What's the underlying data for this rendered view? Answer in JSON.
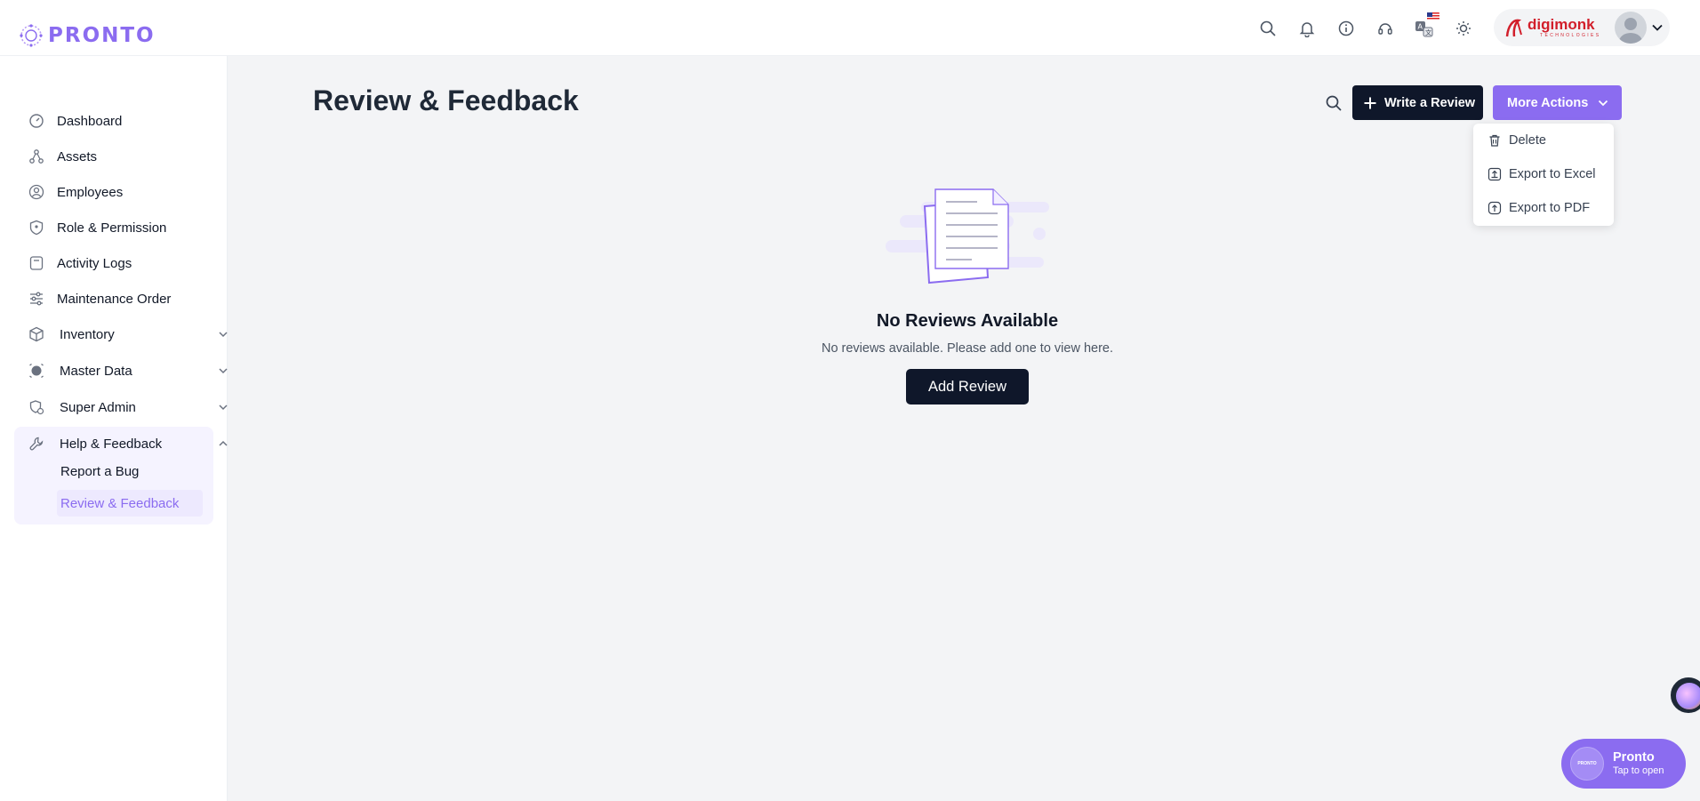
{
  "app": {
    "name": "PRONTO"
  },
  "header": {
    "icons": [
      "search-icon",
      "bell-icon",
      "info-icon",
      "support-icon",
      "translate-icon",
      "sun-icon"
    ],
    "brand": {
      "name": "digimonk",
      "sub": "TECHNOLOGIES"
    }
  },
  "sidebar": {
    "items": [
      {
        "label": "Dashboard",
        "icon": "dashboard-icon"
      },
      {
        "label": "Assets",
        "icon": "assets-icon"
      },
      {
        "label": "Employees",
        "icon": "employees-icon"
      },
      {
        "label": "Role & Permission",
        "icon": "shield-icon"
      },
      {
        "label": "Activity Logs",
        "icon": "logs-icon"
      },
      {
        "label": "Maintenance Order",
        "icon": "sliders-icon"
      },
      {
        "label": "Inventory",
        "icon": "box-icon"
      },
      {
        "label": "Master Data",
        "icon": "data-icon"
      },
      {
        "label": "Super Admin",
        "icon": "admin-icon"
      },
      {
        "label": "Help & Feedback",
        "icon": "wrench-icon"
      }
    ],
    "sub_items": [
      {
        "label": "Report a Bug"
      },
      {
        "label": "Review & Feedback"
      }
    ]
  },
  "page": {
    "title": "Review & Feedback",
    "write_button": "Write a Review",
    "more_button": "More Actions",
    "dropdown": [
      {
        "label": "Delete",
        "icon": "trash-icon"
      },
      {
        "label": "Export to Excel",
        "icon": "export-icon"
      },
      {
        "label": "Export to PDF",
        "icon": "pdf-icon"
      }
    ],
    "empty_title": "No Reviews Available",
    "empty_subtitle": "No reviews available. Please add one to view here.",
    "add_button": "Add Review"
  },
  "chat": {
    "title": "Pronto",
    "subtitle": "Tap to open",
    "logo": "PRONTO"
  },
  "colors": {
    "accent": "#8b6cf0",
    "dark": "#0f172a",
    "brand_red": "#d21f2b",
    "background": "#f3f4f6"
  }
}
